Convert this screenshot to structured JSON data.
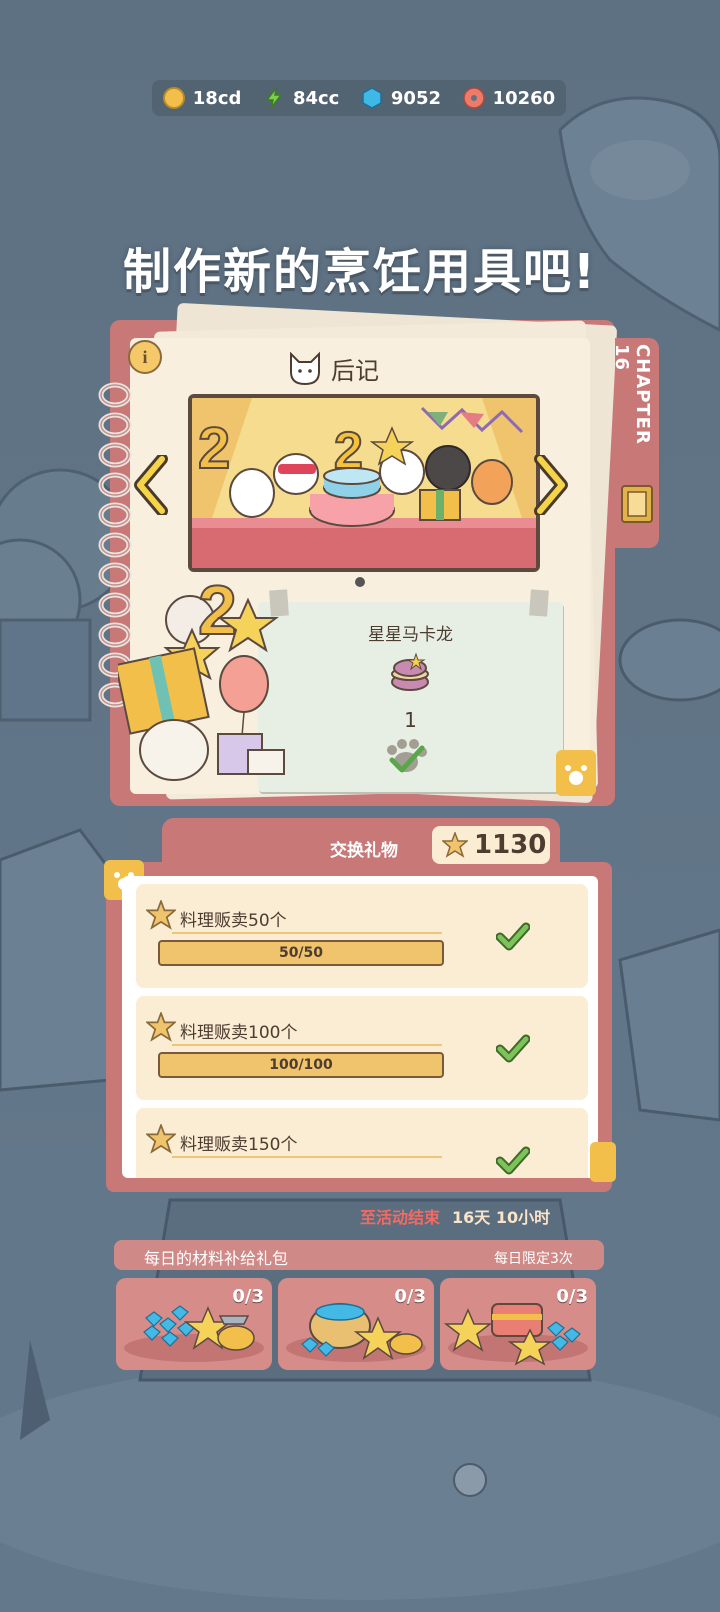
{
  "currencies": [
    {
      "name": "coin",
      "value": "18cd",
      "color": "#f2c04a"
    },
    {
      "name": "energy",
      "value": "84cc",
      "color": "#7bd04a"
    },
    {
      "name": "gem",
      "value": "9052",
      "color": "#3fb8e6"
    },
    {
      "name": "donut",
      "value": "10260",
      "color": "#f07a6a"
    }
  ],
  "headline": "制作新的烹饪用具吧!",
  "album": {
    "page_title": "后记",
    "chapter": "CHAPTER 16",
    "info_icon": "i",
    "reward": {
      "name": "星星马卡龙",
      "count": "1"
    }
  },
  "exchange": {
    "label": "交换礼物",
    "star_count": "1130",
    "tasks": [
      {
        "label": "料理贩卖50个",
        "progress": "50/50",
        "fraction": 1.0,
        "done": true
      },
      {
        "label": "料理贩卖100个",
        "progress": "100/100",
        "fraction": 1.0,
        "done": true
      },
      {
        "label": "料理贩卖150个",
        "progress": "",
        "fraction": 1.0,
        "done": true
      }
    ]
  },
  "timer": {
    "label": "至活动结束",
    "value": "16天 10小时"
  },
  "packs": {
    "title": "每日的材料补给礼包",
    "limit": "每日限定3次",
    "items": [
      {
        "count": "0/3"
      },
      {
        "count": "0/3"
      },
      {
        "count": "0/3"
      }
    ]
  },
  "colors": {
    "panel": "#c97878",
    "paper": "#f8efde",
    "accent": "#f0c46d",
    "check": "#5aa64a"
  }
}
